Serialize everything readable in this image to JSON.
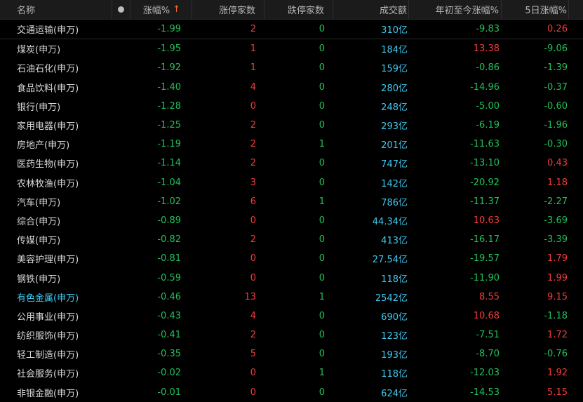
{
  "header": {
    "name": "名称",
    "change_pct": "涨幅%",
    "sort_arrow": "↑",
    "limit_up": "涨停家数",
    "limit_down": "跌停家数",
    "volume": "成交额",
    "ytd": "年初至今涨幅%",
    "five_day": "5日涨幅%"
  },
  "rows": [
    {
      "name": "交通运输(申万)",
      "chg": "-1.99",
      "up": "2",
      "down": "0",
      "vol": "310亿",
      "ytd": "-9.83",
      "d5": "0.26"
    },
    {
      "name": "煤炭(申万)",
      "chg": "-1.95",
      "up": "1",
      "down": "0",
      "vol": "184亿",
      "ytd": "13.38",
      "d5": "-9.06"
    },
    {
      "name": "石油石化(申万)",
      "chg": "-1.92",
      "up": "1",
      "down": "0",
      "vol": "159亿",
      "ytd": "-0.86",
      "d5": "-1.39"
    },
    {
      "name": "食品饮料(申万)",
      "chg": "-1.40",
      "up": "4",
      "down": "0",
      "vol": "280亿",
      "ytd": "-14.96",
      "d5": "-0.37"
    },
    {
      "name": "银行(申万)",
      "chg": "-1.28",
      "up": "0",
      "down": "0",
      "vol": "248亿",
      "ytd": "-5.00",
      "d5": "-0.60"
    },
    {
      "name": "家用电器(申万)",
      "chg": "-1.25",
      "up": "2",
      "down": "0",
      "vol": "293亿",
      "ytd": "-6.19",
      "d5": "-1.96"
    },
    {
      "name": "房地产(申万)",
      "chg": "-1.19",
      "up": "2",
      "down": "1",
      "vol": "201亿",
      "ytd": "-11.63",
      "d5": "-0.30"
    },
    {
      "name": "医药生物(申万)",
      "chg": "-1.14",
      "up": "2",
      "down": "0",
      "vol": "747亿",
      "ytd": "-13.10",
      "d5": "0.43"
    },
    {
      "name": "农林牧渔(申万)",
      "chg": "-1.04",
      "up": "3",
      "down": "0",
      "vol": "142亿",
      "ytd": "-20.92",
      "d5": "1.18"
    },
    {
      "name": "汽车(申万)",
      "chg": "-1.02",
      "up": "6",
      "down": "1",
      "vol": "786亿",
      "ytd": "-11.37",
      "d5": "-2.27"
    },
    {
      "name": "综合(申万)",
      "chg": "-0.89",
      "up": "0",
      "down": "0",
      "vol": "44.34亿",
      "ytd": "10.63",
      "d5": "-3.69"
    },
    {
      "name": "传媒(申万)",
      "chg": "-0.82",
      "up": "2",
      "down": "0",
      "vol": "413亿",
      "ytd": "-16.17",
      "d5": "-3.39"
    },
    {
      "name": "美容护理(申万)",
      "chg": "-0.81",
      "up": "0",
      "down": "0",
      "vol": "27.54亿",
      "ytd": "-19.57",
      "d5": "1.79"
    },
    {
      "name": "钢铁(申万)",
      "chg": "-0.59",
      "up": "0",
      "down": "0",
      "vol": "118亿",
      "ytd": "-11.90",
      "d5": "1.99"
    },
    {
      "name": "有色金属(申万)",
      "chg": "-0.46",
      "up": "13",
      "down": "1",
      "vol": "2542亿",
      "ytd": "8.55",
      "d5": "9.15",
      "highlight": true
    },
    {
      "name": "公用事业(申万)",
      "chg": "-0.43",
      "up": "4",
      "down": "0",
      "vol": "690亿",
      "ytd": "10.68",
      "d5": "-1.18"
    },
    {
      "name": "纺织服饰(申万)",
      "chg": "-0.41",
      "up": "2",
      "down": "0",
      "vol": "123亿",
      "ytd": "-7.51",
      "d5": "1.72"
    },
    {
      "name": "轻工制造(申万)",
      "chg": "-0.35",
      "up": "5",
      "down": "0",
      "vol": "193亿",
      "ytd": "-8.70",
      "d5": "-0.76"
    },
    {
      "name": "社会服务(申万)",
      "chg": "-0.02",
      "up": "0",
      "down": "1",
      "vol": "118亿",
      "ytd": "-12.03",
      "d5": "1.92"
    },
    {
      "name": "非银金融(申万)",
      "chg": "-0.01",
      "up": "0",
      "down": "0",
      "vol": "624亿",
      "ytd": "-14.53",
      "d5": "5.15"
    }
  ],
  "colors": {
    "up_red": "#f23b3b",
    "down_green": "#23c05a",
    "volume_cyan": "#3ec8ee",
    "sort_arrow": "#ff6a2a"
  }
}
